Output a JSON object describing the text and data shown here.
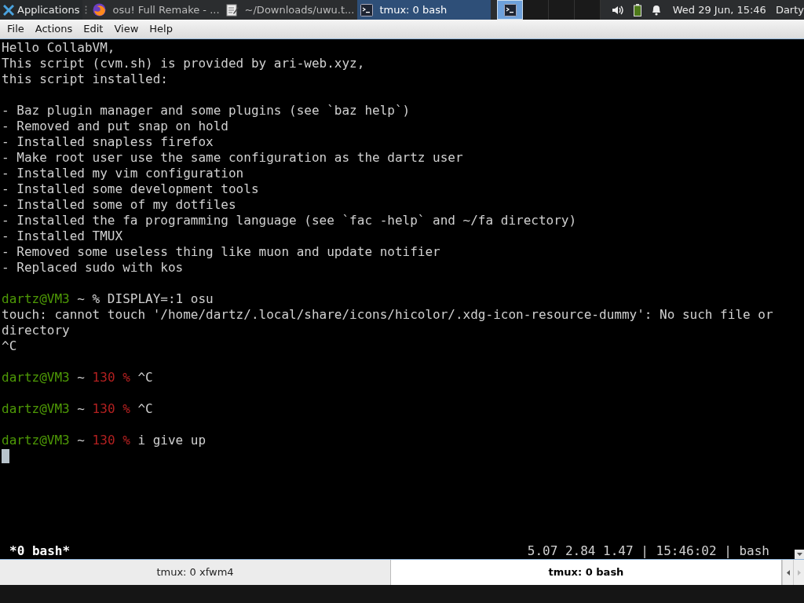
{
  "taskbar": {
    "apps_menu": "Applications",
    "windows": [
      {
        "title": "osu! Full Remake - ...",
        "kind": "browser",
        "selected": false
      },
      {
        "title": "~/Downloads/uwu.t...",
        "kind": "editor",
        "selected": false
      },
      {
        "title": "tmux: 0 bash",
        "kind": "terminal",
        "selected": true
      }
    ],
    "workspaces": [
      {
        "selected": true
      },
      {
        "selected": false
      },
      {
        "selected": false
      },
      {
        "selected": false
      }
    ],
    "clock": "Wed 29 Jun, 15:46",
    "user": "Darty"
  },
  "menu": [
    "File",
    "Actions",
    "Edit",
    "View",
    "Help"
  ],
  "terminal": {
    "lines": [
      {
        "kind": "output",
        "segments": [
          {
            "kind": "plain",
            "text": "Hello CollabVM,"
          }
        ]
      },
      {
        "kind": "output",
        "segments": [
          {
            "kind": "plain",
            "text": "This script (cvm.sh) is provided by ari-web.xyz,"
          }
        ]
      },
      {
        "kind": "output",
        "segments": [
          {
            "kind": "plain",
            "text": "this script installed:"
          }
        ]
      },
      {
        "kind": "blank"
      },
      {
        "kind": "output",
        "segments": [
          {
            "kind": "plain",
            "text": "- Baz plugin manager and some plugins (see `baz help`)"
          }
        ]
      },
      {
        "kind": "output",
        "segments": [
          {
            "kind": "plain",
            "text": "- Removed and put snap on hold"
          }
        ]
      },
      {
        "kind": "output",
        "segments": [
          {
            "kind": "plain",
            "text": "- Installed snapless firefox"
          }
        ]
      },
      {
        "kind": "output",
        "segments": [
          {
            "kind": "plain",
            "text": "- Make root user use the same configuration as the dartz user"
          }
        ]
      },
      {
        "kind": "output",
        "segments": [
          {
            "kind": "plain",
            "text": "- Installed my vim configuration"
          }
        ]
      },
      {
        "kind": "output",
        "segments": [
          {
            "kind": "plain",
            "text": "- Installed some development tools"
          }
        ]
      },
      {
        "kind": "output",
        "segments": [
          {
            "kind": "plain",
            "text": "- Installed some of my dotfiles"
          }
        ]
      },
      {
        "kind": "output",
        "segments": [
          {
            "kind": "plain",
            "text": "- Installed the fa programming language (see `fac -help` and ~/fa directory)"
          }
        ]
      },
      {
        "kind": "output",
        "segments": [
          {
            "kind": "plain",
            "text": "- Installed TMUX"
          }
        ]
      },
      {
        "kind": "output",
        "segments": [
          {
            "kind": "plain",
            "text": "- Removed some useless thing like muon and update notifier"
          }
        ]
      },
      {
        "kind": "output",
        "segments": [
          {
            "kind": "plain",
            "text": "- Replaced sudo with kos"
          }
        ]
      },
      {
        "kind": "blank"
      },
      {
        "kind": "prompt",
        "segments": [
          {
            "kind": "user",
            "text": "dartz@VM3"
          },
          {
            "kind": "plain",
            "text": " ~ % DISPLAY=:1 osu"
          }
        ]
      },
      {
        "kind": "output",
        "segments": [
          {
            "kind": "plain",
            "text": "touch: cannot touch '/home/dartz/.local/share/icons/hicolor/.xdg-icon-resource-dummy': No such file or directory"
          }
        ]
      },
      {
        "kind": "output",
        "segments": [
          {
            "kind": "plain",
            "text": "^C"
          }
        ]
      },
      {
        "kind": "blank"
      },
      {
        "kind": "prompt",
        "segments": [
          {
            "kind": "user",
            "text": "dartz@VM3"
          },
          {
            "kind": "plain",
            "text": " ~ "
          },
          {
            "kind": "error",
            "text": "130 %"
          },
          {
            "kind": "plain",
            "text": " ^C"
          }
        ]
      },
      {
        "kind": "blank"
      },
      {
        "kind": "prompt",
        "segments": [
          {
            "kind": "user",
            "text": "dartz@VM3"
          },
          {
            "kind": "plain",
            "text": " ~ "
          },
          {
            "kind": "error",
            "text": "130 %"
          },
          {
            "kind": "plain",
            "text": " ^C"
          }
        ]
      },
      {
        "kind": "blank"
      },
      {
        "kind": "prompt",
        "segments": [
          {
            "kind": "user",
            "text": "dartz@VM3"
          },
          {
            "kind": "plain",
            "text": " ~ "
          },
          {
            "kind": "error",
            "text": "130 %"
          },
          {
            "kind": "plain",
            "text": " i give up"
          }
        ]
      },
      {
        "kind": "cursor"
      }
    ],
    "status_left": "*0 bash*",
    "status_right": "5.07 2.84 1.47 | 15:46:02 | bash"
  },
  "tabs": [
    {
      "label": "tmux: 0 xfwm4",
      "selected": false
    },
    {
      "label": "tmux: 0 bash",
      "selected": true
    }
  ]
}
